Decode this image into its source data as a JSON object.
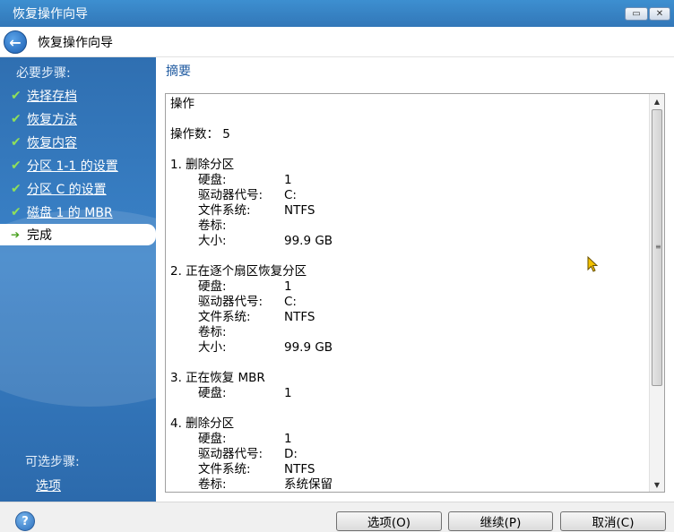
{
  "window": {
    "title": "恢复操作向导"
  },
  "header": {
    "title": "恢复操作向导"
  },
  "sidebar": {
    "required_label": "必要步骤:",
    "steps": [
      {
        "label": "选择存档",
        "done": true
      },
      {
        "label": "恢复方法",
        "done": true
      },
      {
        "label": "恢复内容",
        "done": true
      },
      {
        "label": "分区 1-1 的设置",
        "done": true
      },
      {
        "label": "分区 C 的设置",
        "done": true
      },
      {
        "label": "磁盘 1 的 MBR",
        "done": true
      },
      {
        "label": "完成",
        "done": false,
        "active": true
      }
    ],
    "optional_label": "可选步骤:",
    "optional_link": "选项"
  },
  "main": {
    "title": "摘要",
    "summary": {
      "heading": "操作",
      "count_label": "操作数：",
      "count_value": "5",
      "operations": [
        {
          "title": "1. 删除分区",
          "rows": [
            {
              "k": "硬盘:",
              "v": "1"
            },
            {
              "k": "驱动器代号:",
              "v": "C:"
            },
            {
              "k": "文件系统:",
              "v": "NTFS"
            },
            {
              "k": "卷标:",
              "v": ""
            },
            {
              "k": "大小:",
              "v": "99.9 GB"
            }
          ]
        },
        {
          "title": "2. 正在逐个扇区恢复分区",
          "rows": [
            {
              "k": "硬盘:",
              "v": "1"
            },
            {
              "k": "驱动器代号:",
              "v": "C:"
            },
            {
              "k": "文件系统:",
              "v": "NTFS"
            },
            {
              "k": "卷标:",
              "v": ""
            },
            {
              "k": "大小:",
              "v": "99.9 GB"
            }
          ]
        },
        {
          "title": "3. 正在恢复 MBR",
          "rows": [
            {
              "k": "硬盘:",
              "v": "1"
            }
          ]
        },
        {
          "title": "4. 删除分区",
          "rows": [
            {
              "k": "硬盘:",
              "v": "1"
            },
            {
              "k": "驱动器代号:",
              "v": "D:"
            },
            {
              "k": "文件系统:",
              "v": "NTFS"
            },
            {
              "k": "卷标:",
              "v": "系统保留"
            }
          ]
        }
      ]
    }
  },
  "footer": {
    "help_icon_text": "?",
    "options_button": "选项(O)",
    "continue_button": "继续(P)",
    "cancel_button": "取消(C)"
  },
  "colors": {
    "title_bar": "#3277b8",
    "sidebar": "#3a82c8",
    "link_title": "#1f5aa0",
    "check": "#8fe05a"
  },
  "icons": {
    "back": "back-arrow-icon",
    "help": "help-icon",
    "check": "checkmark-icon",
    "current": "arrow-right-icon"
  }
}
